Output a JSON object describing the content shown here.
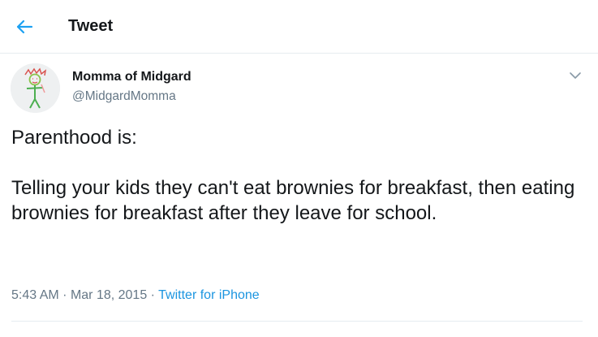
{
  "header": {
    "back_icon": "arrow-left-icon",
    "title": "Tweet",
    "accent_color": "#1da1f2"
  },
  "author": {
    "name": "Momma of Midgard",
    "handle": "@MidgardMomma",
    "avatar_icon": "stick-figure-drawing",
    "menu_icon": "chevron-down-icon"
  },
  "tweet": {
    "paragraphs": [
      "Parenthood is:",
      "Telling your kids they can't eat brownies for breakfast, then eating brownies for breakfast after they leave for school."
    ],
    "time": "5:43 AM",
    "separator": "·",
    "date": "Mar 18, 2015",
    "source": "Twitter for iPhone",
    "source_color": "#1b95e0"
  }
}
